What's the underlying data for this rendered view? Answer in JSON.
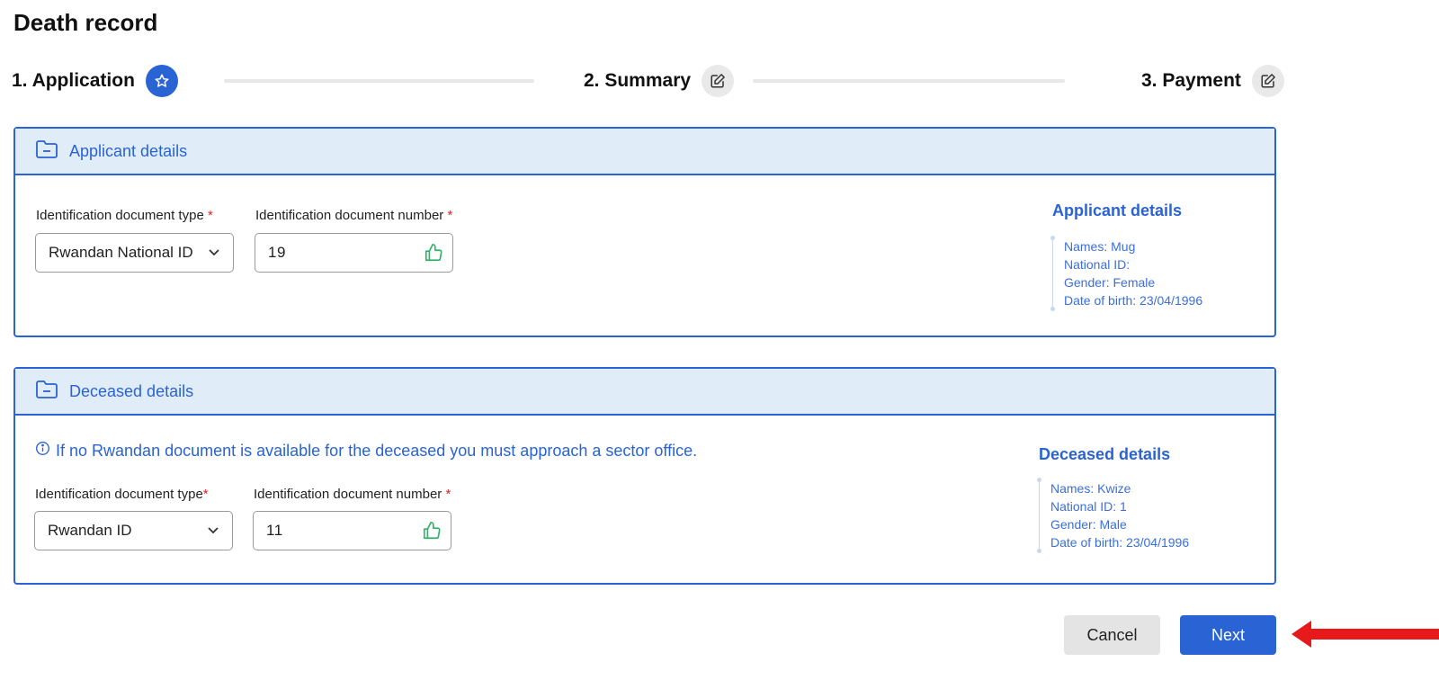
{
  "page_title": "Death record",
  "stepper": [
    {
      "label": "1. Application",
      "icon": "star-icon",
      "state": "active"
    },
    {
      "label": "2. Summary",
      "icon": "edit-icon",
      "state": "inactive"
    },
    {
      "label": "3. Payment",
      "icon": "edit-icon",
      "state": "inactive"
    }
  ],
  "applicant": {
    "title": "Applicant details",
    "doc_type_label": "Identification document type",
    "doc_type_value": "Rwandan National ID",
    "doc_number_label": "Identification document number",
    "doc_number_value": "19              ",
    "required_mark": "*",
    "summary": {
      "title": "Applicant details",
      "names": "Names: Mug",
      "national_id": "National ID:",
      "gender": "Gender: Female",
      "dob": "Date of birth: 23/04/1996"
    }
  },
  "deceased": {
    "title": "Deceased details",
    "info": "If no Rwandan document is available for the deceased you must approach a sector office.",
    "doc_type_label": "Identification document type",
    "doc_type_value": "Rwandan ID",
    "doc_number_label": "Identification document number",
    "doc_number_value": "11              ",
    "required_mark": "*",
    "summary": {
      "title": "Deceased details",
      "names": "Names: Kwize",
      "national_id": "National ID: 1",
      "gender": "Gender: Male",
      "dob": "Date of birth: 23/04/1996"
    }
  },
  "buttons": {
    "cancel": "Cancel",
    "next": "Next"
  },
  "colors": {
    "accent": "#2a63d4",
    "header_bg": "#e1ecf9",
    "success": "#2fb36b",
    "required": "#e02424",
    "annotation_arrow": "#e8191a"
  }
}
